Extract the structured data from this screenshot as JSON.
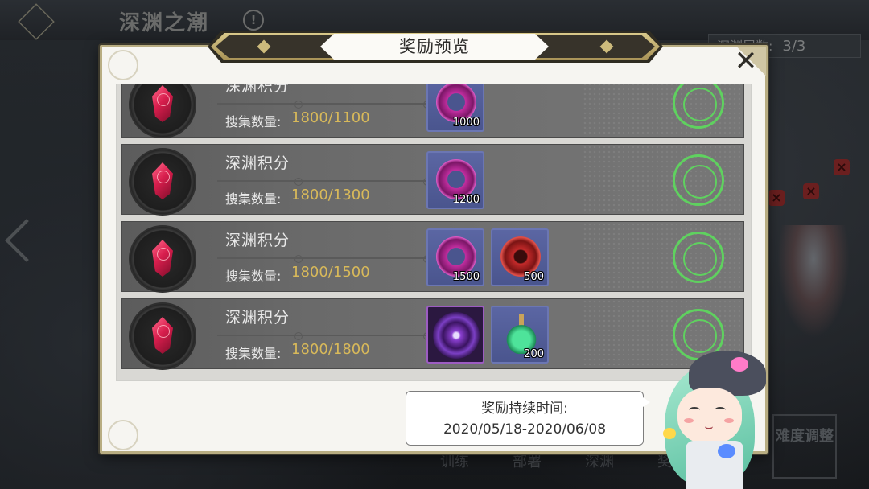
{
  "background": {
    "title": "深渊之潮",
    "info_icon": "!",
    "layer_label": "深渊层数:",
    "layer_value": "3/3",
    "difficulty_button": "难度调整",
    "bottom_buttons": [
      "训练",
      "部署",
      "深渊",
      "奖励"
    ]
  },
  "modal": {
    "title": "奖励预览",
    "close_icon": "✕",
    "rows": [
      {
        "title": "深渊积分",
        "qty_label": "搜集数量:",
        "qty_value": "1800/1100",
        "items": [
          {
            "icon": "abyss-gear-icon",
            "count": "1000"
          }
        ],
        "claimed": true
      },
      {
        "title": "深渊积分",
        "qty_label": "搜集数量:",
        "qty_value": "1800/1300",
        "items": [
          {
            "icon": "abyss-gear-icon",
            "count": "1200"
          }
        ],
        "claimed": true
      },
      {
        "title": "深渊积分",
        "qty_label": "搜集数量:",
        "qty_value": "1800/1500",
        "items": [
          {
            "icon": "abyss-gear-icon",
            "count": "1500"
          },
          {
            "icon": "red-gear-icon",
            "count": "500"
          }
        ],
        "claimed": true
      },
      {
        "title": "深渊积分",
        "qty_label": "搜集数量:",
        "qty_value": "1800/1800",
        "items": [
          {
            "icon": "purple-rune-icon",
            "count": ""
          },
          {
            "icon": "green-potion-icon",
            "count": "200"
          }
        ],
        "claimed": true
      }
    ],
    "bubble": {
      "line1": "奖励持续时间:",
      "line2": "2020/05/18-2020/06/08"
    }
  },
  "colors": {
    "claimed_green": "#5fd15f",
    "qty_gold": "#d8b95a",
    "modal_border_gold": "#b8ad82"
  }
}
